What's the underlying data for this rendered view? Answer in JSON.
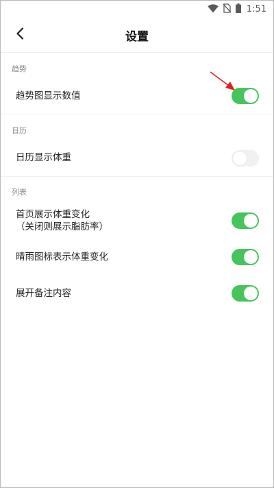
{
  "status_bar": {
    "time": "1:51",
    "icons": [
      "wifi-icon",
      "no-sim-icon",
      "battery-icon"
    ]
  },
  "header": {
    "title": "设置",
    "back_icon": "chevron-left-icon"
  },
  "sections": [
    {
      "title": "趋势",
      "items": [
        {
          "label": "趋势图显示数值",
          "enabled": true
        }
      ]
    },
    {
      "title": "日历",
      "items": [
        {
          "label": "日历显示体重",
          "enabled": false
        }
      ]
    },
    {
      "title": "列表",
      "items": [
        {
          "label": "首页展示体重变化",
          "sublabel": "（关闭则展示脂肪率）",
          "enabled": true
        },
        {
          "label": "晴雨图标表示体重变化",
          "enabled": true
        },
        {
          "label": "展开备注内容",
          "enabled": true
        }
      ]
    }
  ],
  "colors": {
    "toggle_on": "#47c45b",
    "toggle_off": "#f1f1f4",
    "annotation_arrow": "#e02020"
  }
}
